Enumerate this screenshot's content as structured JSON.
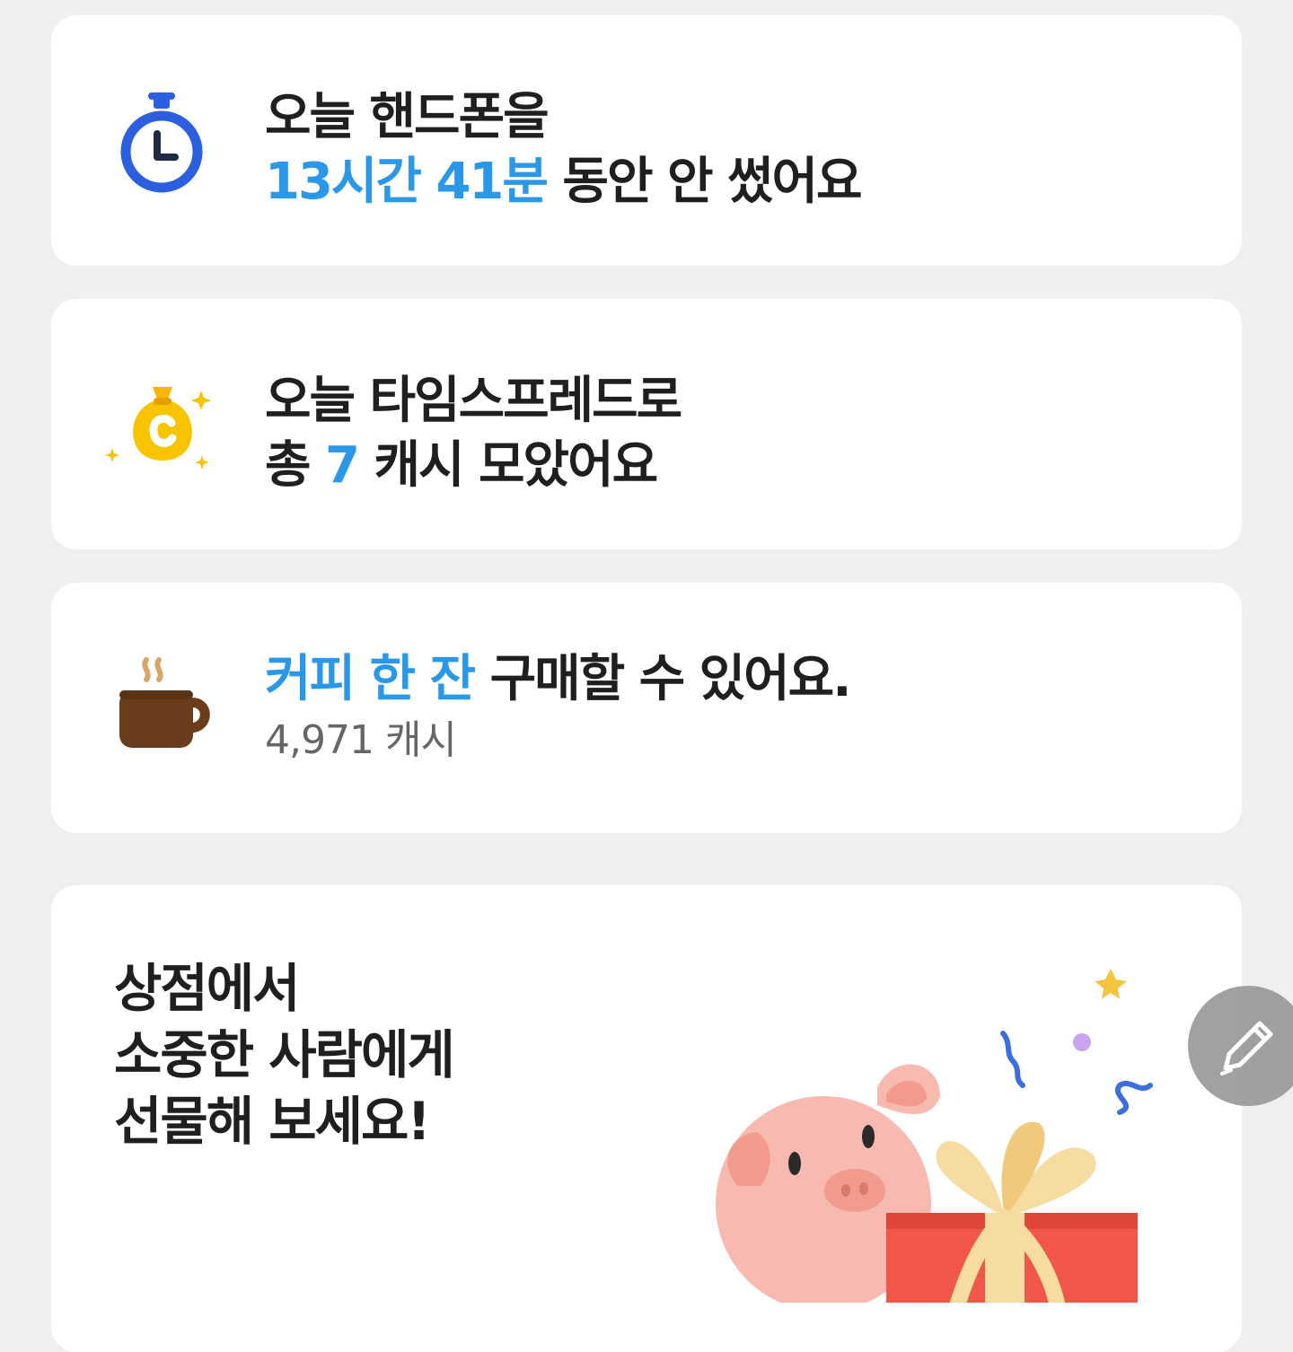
{
  "usage_card": {
    "line1": "오늘 핸드폰을",
    "duration": "13시간 41분",
    "line2_rest": " 동안 안 썼어요",
    "icon": "clock-icon"
  },
  "cash_card": {
    "line1": "오늘 타임스프레드로",
    "line2_prefix": "총 ",
    "amount": "7",
    "line2_rest": " 캐시 모았어요",
    "icon": "money-bag-icon"
  },
  "coffee_card": {
    "highlight": "커피 한 잔",
    "line1_rest": " 구매할 수 있어요.",
    "price": "4,971 캐시",
    "icon": "coffee-cup-icon"
  },
  "shop_card": {
    "line1": "상점에서",
    "line2": "소중한 사람에게",
    "line3": "선물해 보세요!",
    "illustration": "pig-with-gift-illustration"
  },
  "fab": {
    "icon": "pencil-icon"
  },
  "colors": {
    "accent": "#2a97e8",
    "background": "#efefef",
    "card": "#ffffff"
  }
}
